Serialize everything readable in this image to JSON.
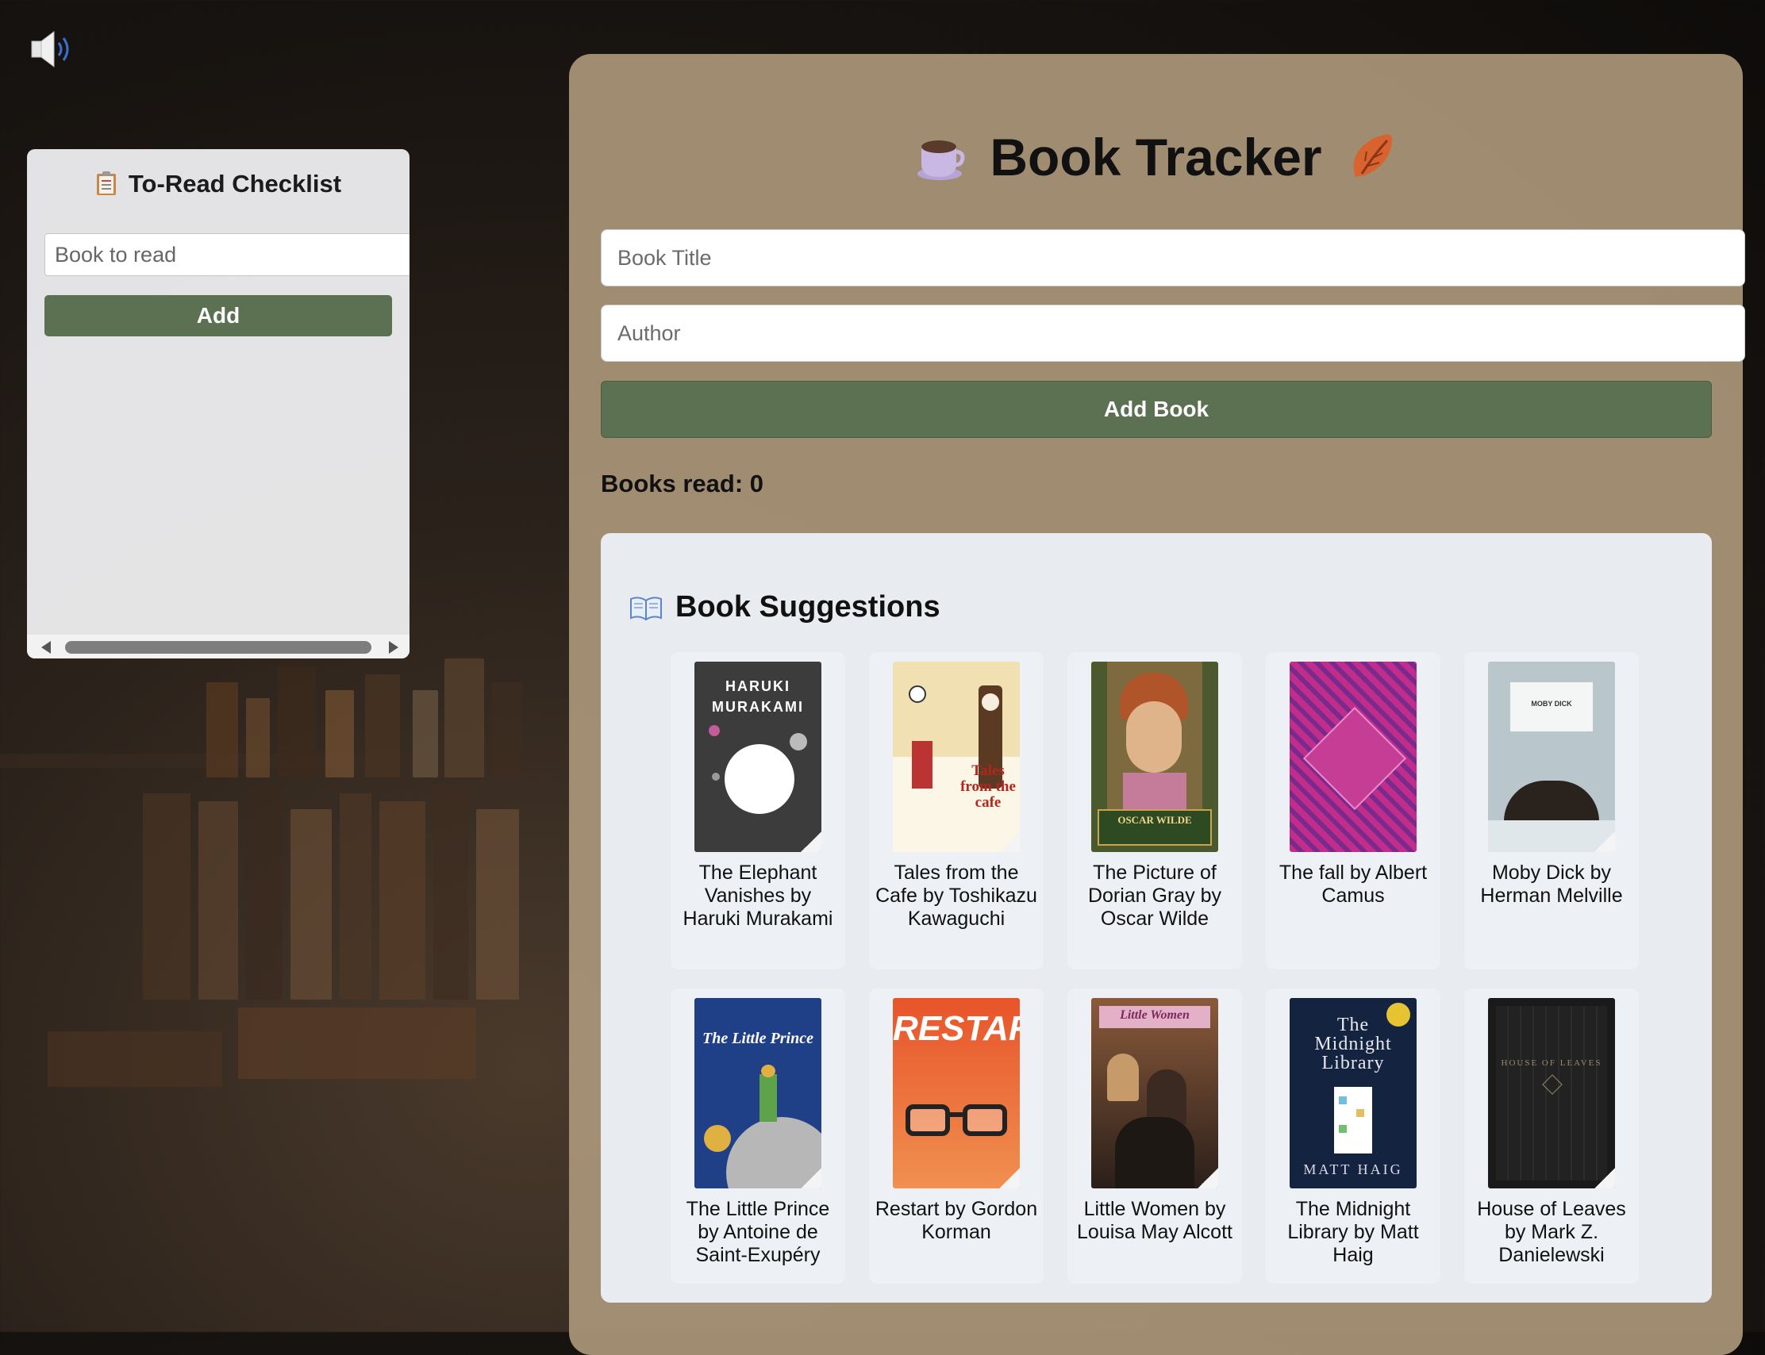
{
  "sound": {
    "icon": "speaker-icon"
  },
  "checklist": {
    "title": "To-Read Checklist",
    "icon": "clipboard-icon",
    "input_placeholder": "Book to read",
    "add_label": "Add"
  },
  "tracker": {
    "title": "Book Tracker",
    "title_icon_left": "coffee-cup-icon",
    "title_icon_right": "fallen-leaf-icon",
    "title_placeholder": "Book Title",
    "author_placeholder": "Author",
    "add_book_label": "Add Book",
    "books_read": "Books read: 0"
  },
  "suggestions": {
    "heading": "Book Suggestions",
    "icon": "open-book-icon",
    "books": [
      {
        "caption": "The Elephant Vanishes by Haruki Murakami",
        "cover_colors": [
          "#3c3c3c",
          "#8a8a8a"
        ],
        "cover_text": "HARUKI MURAKAMI"
      },
      {
        "caption": "Tales from the Cafe by Toshikazu Kawaguchi",
        "cover_colors": [
          "#f1e0b2",
          "#ffffff"
        ],
        "cover_text": "Tales from the cafe"
      },
      {
        "caption": "The Picture of Dorian Gray by Oscar Wilde",
        "cover_colors": [
          "#4b5a2e",
          "#b88a5a"
        ],
        "cover_text": "OSCAR WILDE"
      },
      {
        "caption": "The fall by Albert Camus",
        "cover_colors": [
          "#c02d8a",
          "#7a2a8c"
        ],
        "cover_text": ""
      },
      {
        "caption": "Moby Dick by Herman Melville",
        "cover_colors": [
          "#b9c6cc",
          "#dfe7ea"
        ],
        "cover_text": "MOBY DICK"
      },
      {
        "caption": "The Little Prince by Antoine de Saint-Exupéry",
        "cover_colors": [
          "#1f3f86",
          "#2a55a8"
        ],
        "cover_text": "The Little Prince"
      },
      {
        "caption": "Restart by Gordon Korman",
        "cover_colors": [
          "#e8542a",
          "#f08a4a"
        ],
        "cover_text": "RESTART"
      },
      {
        "caption": "Little Women by Louisa May Alcott",
        "cover_colors": [
          "#6a3f2a",
          "#2a1f1a"
        ],
        "cover_text": "Little Women"
      },
      {
        "caption": "The Midnight Library by Matt Haig",
        "cover_colors": [
          "#14233f",
          "#1d3560"
        ],
        "cover_text": "The Midnight Library"
      },
      {
        "caption": "House of Leaves by Mark Z. Danielewski",
        "cover_colors": [
          "#1a1a1a",
          "#2a2a2a"
        ],
        "cover_text": "HOUSE OF LEAVES"
      }
    ]
  }
}
